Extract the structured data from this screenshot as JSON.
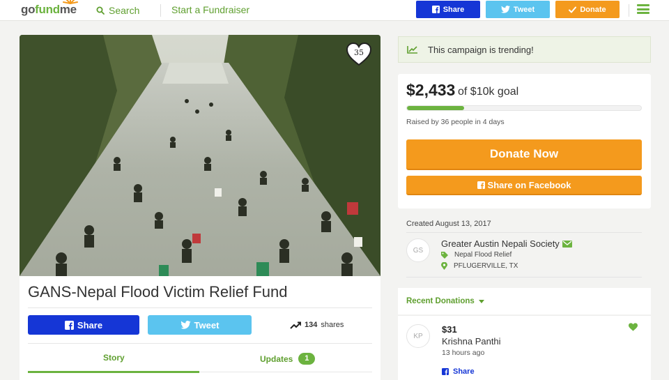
{
  "header": {
    "logo_go": "go",
    "logo_fund": "fund",
    "logo_me": "me",
    "search_label": "Search",
    "start_label": "Start a Fundraiser",
    "share_label": "Share",
    "tweet_label": "Tweet",
    "donate_label": "Donate",
    "colors": {
      "facebook": "#1536d6",
      "twitter": "#5bc4ef",
      "donate": "#f49a1d",
      "brand_green": "#6cb33f"
    }
  },
  "campaign": {
    "heart_count": "35",
    "title": "GANS-Nepal Flood Victim Relief Fund",
    "share_label": "Share",
    "tweet_label": "Tweet",
    "shares_count": "134",
    "shares_suffix": "shares",
    "tabs": [
      {
        "label": "Story",
        "active": true
      },
      {
        "label": "Updates",
        "badge": "1"
      }
    ]
  },
  "sidebar": {
    "trending_text": "This campaign is trending!",
    "raised_amount": "$2,433",
    "goal_text": "of $10k goal",
    "progress_fraction": 0.2433,
    "raised_by_text": "Raised by 36 people in 4 days",
    "donate_now_label": "Donate Now",
    "share_facebook_label": "Share on Facebook",
    "created_text": "Created August 13, 2017",
    "organizer": {
      "initials": "GS",
      "name": "Greater Austin Nepali Society",
      "category": "Nepal Flood Relief",
      "location": "PFLUGERVILLE, TX"
    },
    "recent_donations_label": "Recent Donations",
    "donations": [
      {
        "initials": "KP",
        "amount": "$31",
        "name": "Krishna Panthi",
        "time": "13 hours ago",
        "share_label": "Share"
      }
    ]
  }
}
